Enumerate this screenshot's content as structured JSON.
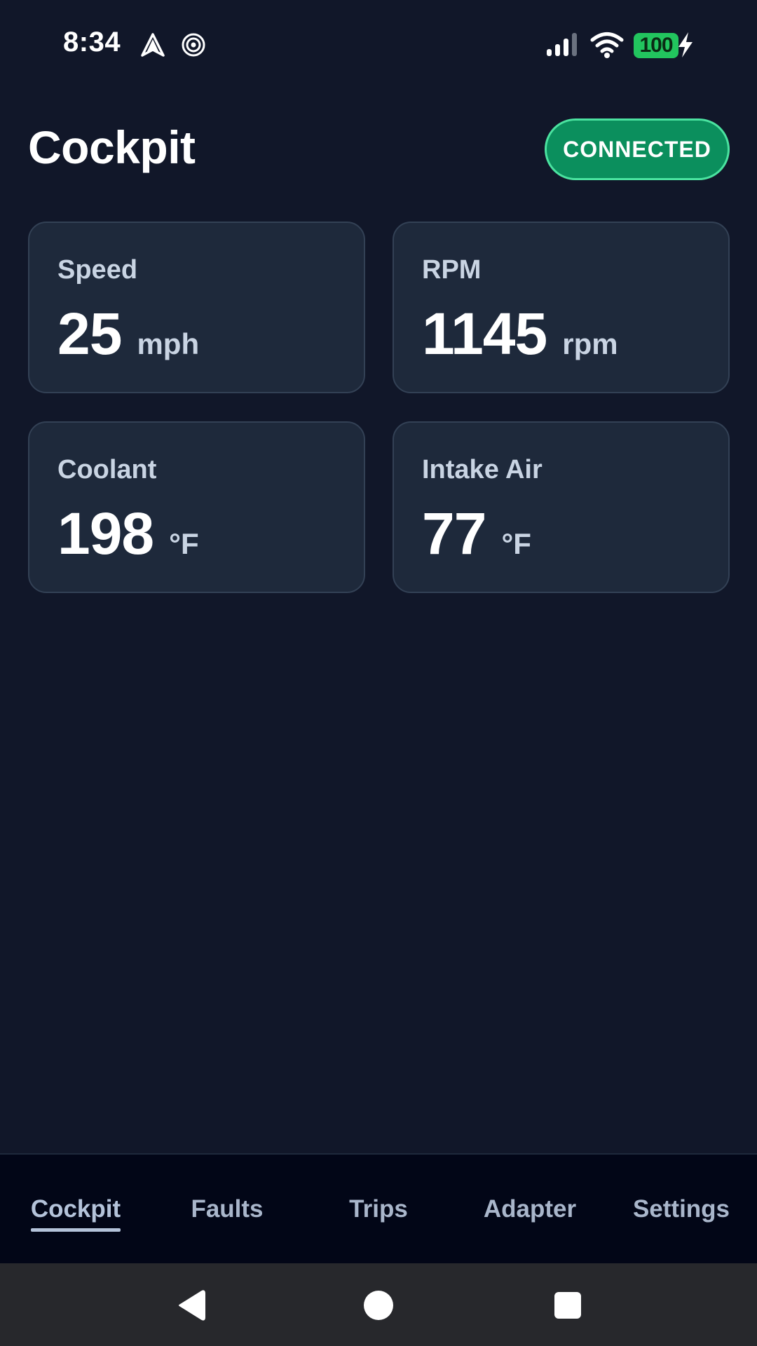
{
  "status_bar": {
    "time": "8:34",
    "battery_level": "100",
    "icons": [
      "navigation-arrow-icon",
      "spiral-icon",
      "cellular-signal-icon",
      "wifi-icon",
      "battery-icon",
      "charging-bolt-icon"
    ]
  },
  "header": {
    "title": "Cockpit",
    "connection_status": "CONNECTED"
  },
  "gauges": [
    {
      "label": "Speed",
      "value": "25",
      "unit": "mph"
    },
    {
      "label": "RPM",
      "value": "1145",
      "unit": "rpm"
    },
    {
      "label": "Coolant",
      "value": "198",
      "unit": "°F"
    },
    {
      "label": "Intake Air",
      "value": "77",
      "unit": "°F"
    }
  ],
  "tabs": [
    {
      "label": "Cockpit",
      "active": true
    },
    {
      "label": "Faults",
      "active": false
    },
    {
      "label": "Trips",
      "active": false
    },
    {
      "label": "Adapter",
      "active": false
    },
    {
      "label": "Settings",
      "active": false
    }
  ],
  "system_nav": {
    "icons": [
      "back-icon",
      "home-icon",
      "recents-icon"
    ]
  },
  "colors": {
    "background": "#111729",
    "card": "#1e293b",
    "connected_pill": "#0b8f5d",
    "battery": "#22c55e",
    "tab_bar": "#020617"
  }
}
